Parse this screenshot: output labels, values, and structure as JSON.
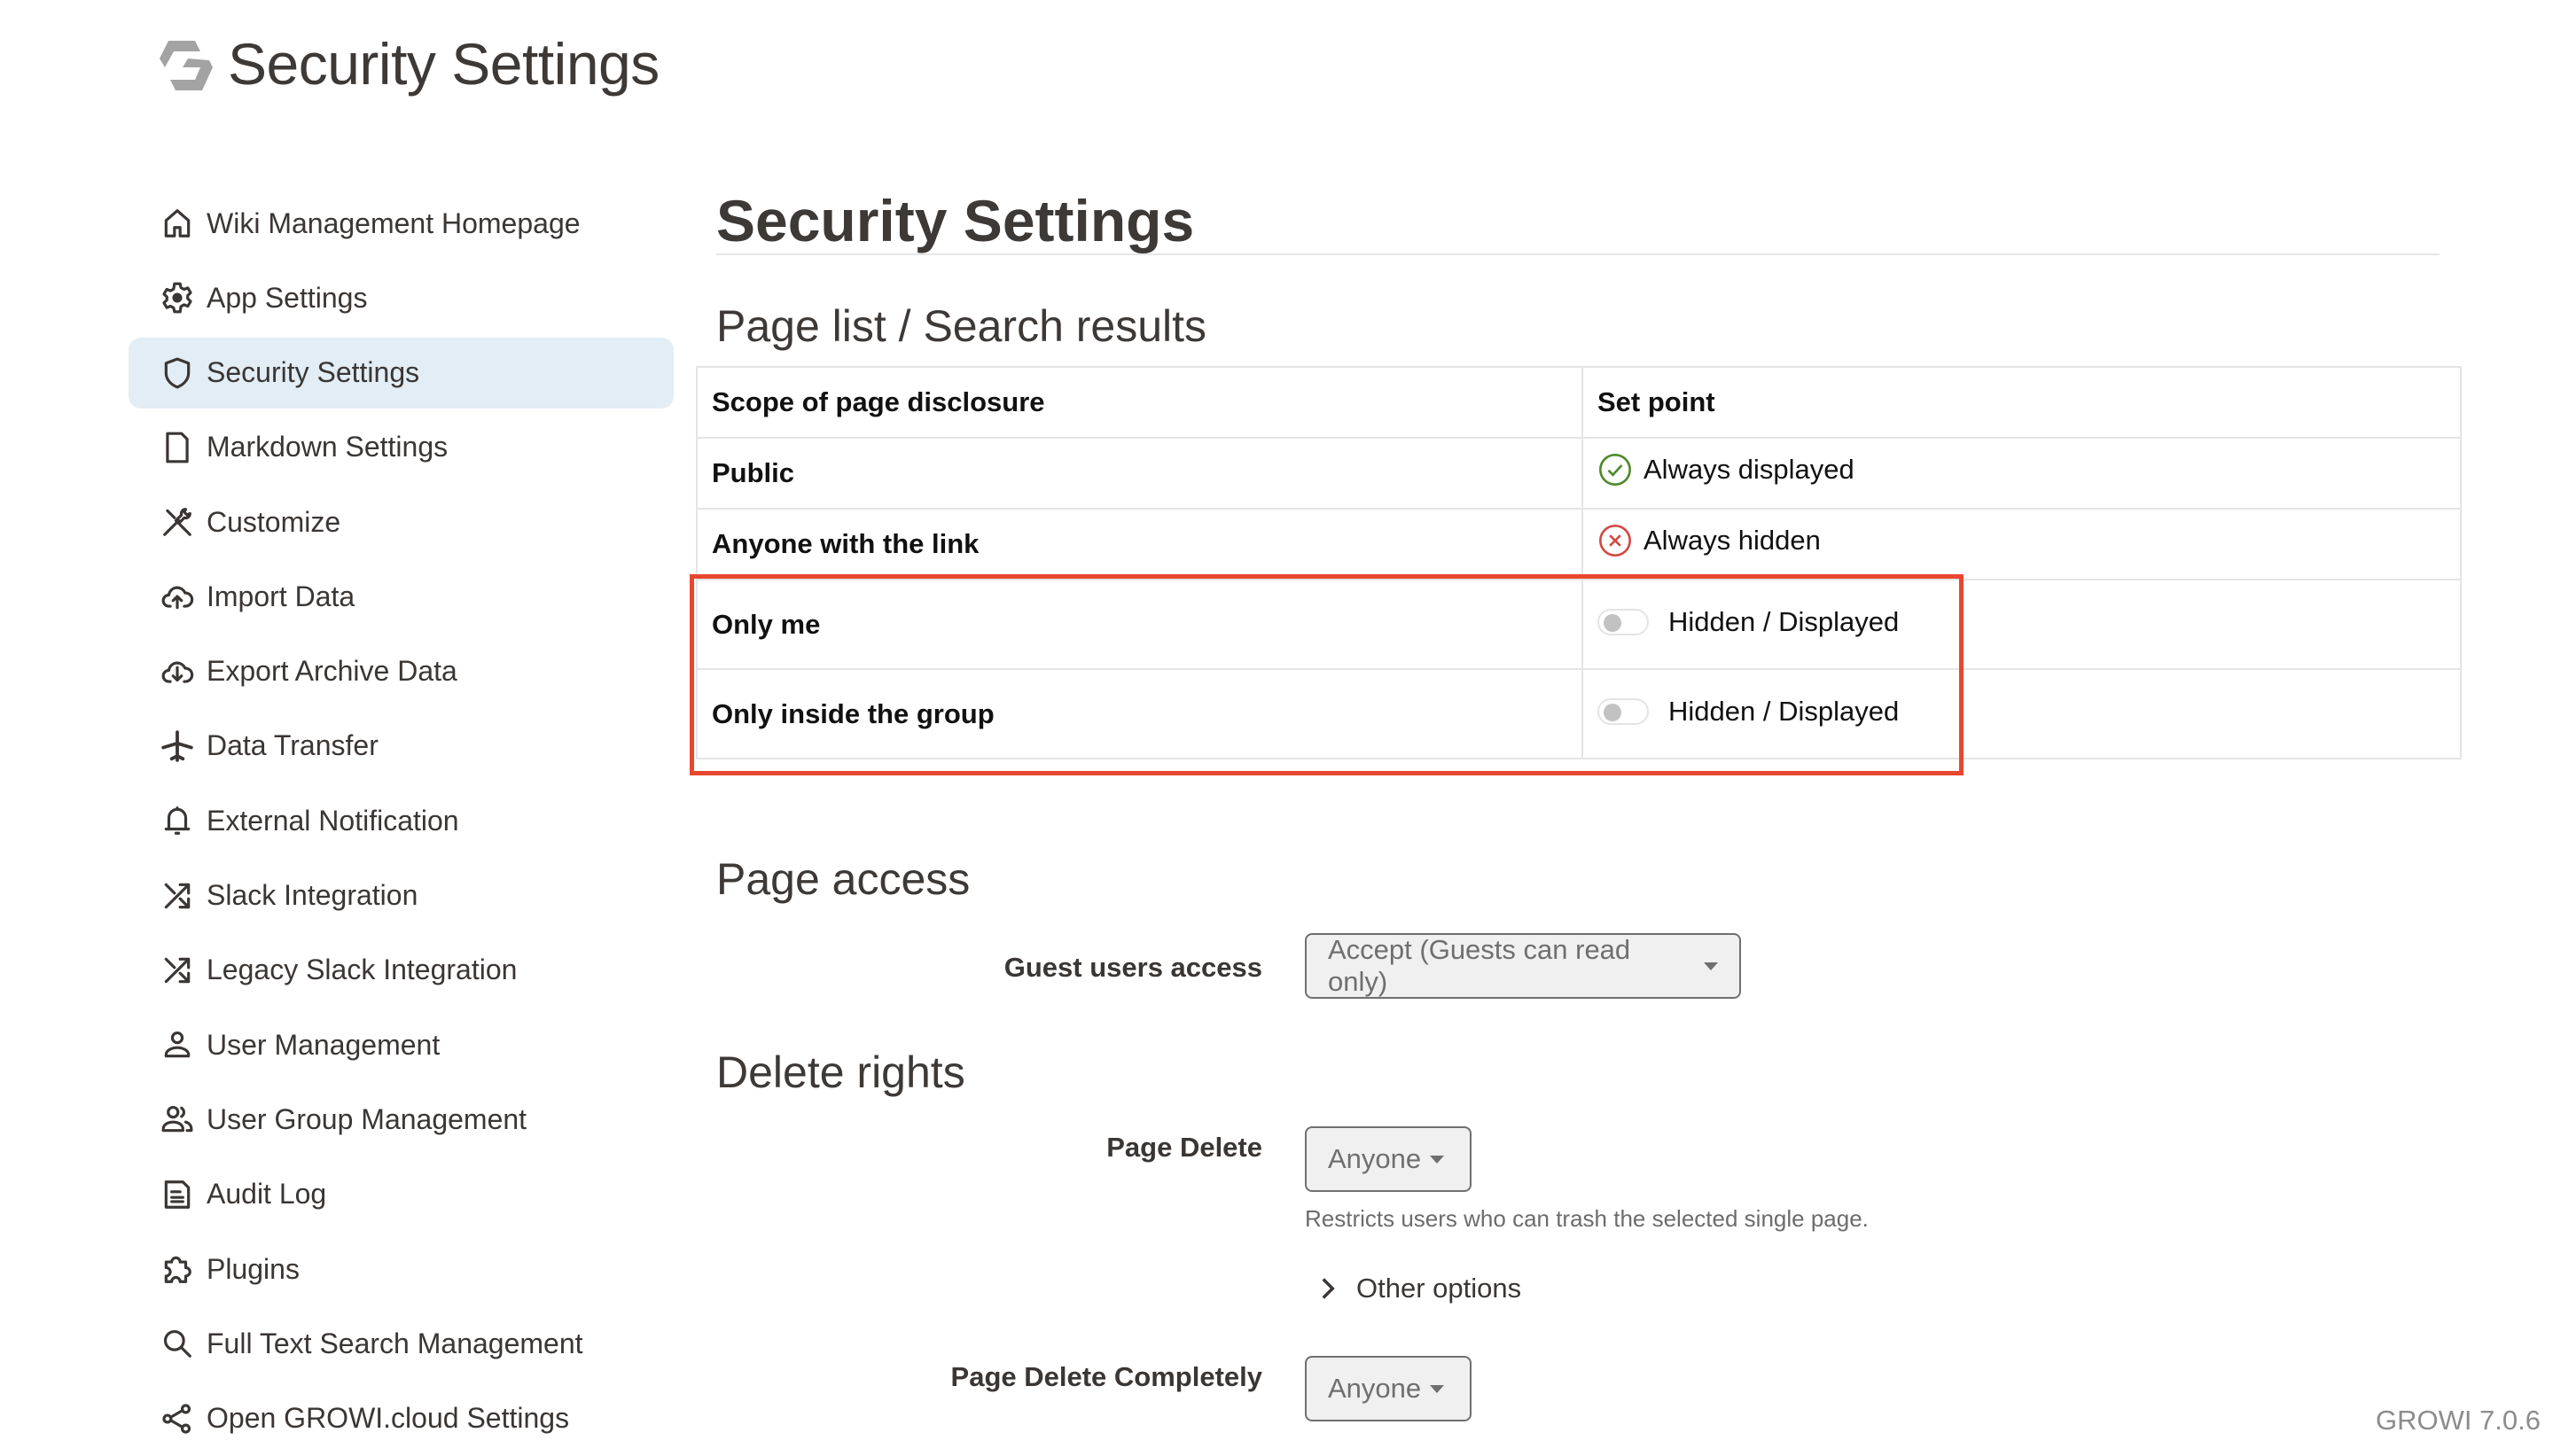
{
  "header": {
    "title": "Security Settings",
    "logo_icon": "growi-logo-icon"
  },
  "sidebar": {
    "items": [
      {
        "label": "Wiki Management Homepage",
        "icon": "home-icon",
        "active": false
      },
      {
        "label": "App Settings",
        "icon": "gear-icon",
        "active": false
      },
      {
        "label": "Security Settings",
        "icon": "shield-icon",
        "active": true
      },
      {
        "label": "Markdown Settings",
        "icon": "file-icon",
        "active": false
      },
      {
        "label": "Customize",
        "icon": "tools-icon",
        "active": false
      },
      {
        "label": "Import Data",
        "icon": "cloud-upload-icon",
        "active": false
      },
      {
        "label": "Export Archive Data",
        "icon": "cloud-download-icon",
        "active": false
      },
      {
        "label": "Data Transfer",
        "icon": "airplane-icon",
        "active": false
      },
      {
        "label": "External Notification",
        "icon": "bell-icon",
        "active": false
      },
      {
        "label": "Slack Integration",
        "icon": "shuffle-icon",
        "active": false
      },
      {
        "label": "Legacy Slack Integration",
        "icon": "shuffle-icon",
        "active": false
      },
      {
        "label": "User Management",
        "icon": "person-icon",
        "active": false
      },
      {
        "label": "User Group Management",
        "icon": "people-icon",
        "active": false
      },
      {
        "label": "Audit Log",
        "icon": "document-icon",
        "active": false
      },
      {
        "label": "Plugins",
        "icon": "puzzle-icon",
        "active": false
      },
      {
        "label": "Full Text Search Management",
        "icon": "search-icon",
        "active": false
      },
      {
        "label": "Open GROWI.cloud Settings",
        "icon": "share-icon",
        "active": false
      }
    ]
  },
  "main": {
    "title": "Security Settings",
    "page_list": {
      "heading": "Page list / Search results",
      "columns": [
        "Scope of page disclosure",
        "Set point"
      ],
      "rows": [
        {
          "scope": "Public",
          "setting": "Always displayed",
          "type": "status",
          "icon": "check-circle-icon",
          "color": "#4e8a2c"
        },
        {
          "scope": "Anyone with the link",
          "setting": "Always hidden",
          "type": "status",
          "icon": "x-circle-icon",
          "color": "#d14a43"
        },
        {
          "scope": "Only me",
          "setting": "Hidden / Displayed",
          "type": "toggle",
          "checked": false
        },
        {
          "scope": "Only inside the group",
          "setting": "Hidden / Displayed",
          "type": "toggle",
          "checked": false
        }
      ]
    },
    "page_access": {
      "heading": "Page access",
      "guest_label": "Guest users access",
      "guest_value": "Accept (Guests can read only)"
    },
    "delete_rights": {
      "heading": "Delete rights",
      "page_delete_label": "Page Delete",
      "page_delete_value": "Anyone",
      "page_delete_help": "Restricts users who can trash the selected single page.",
      "other_options": "Other options",
      "page_delete_completely_label": "Page Delete Completely",
      "page_delete_completely_value": "Anyone"
    }
  },
  "annotation": {
    "highlight_color": "#e8462e"
  },
  "footer": {
    "version": "GROWI 7.0.6"
  }
}
